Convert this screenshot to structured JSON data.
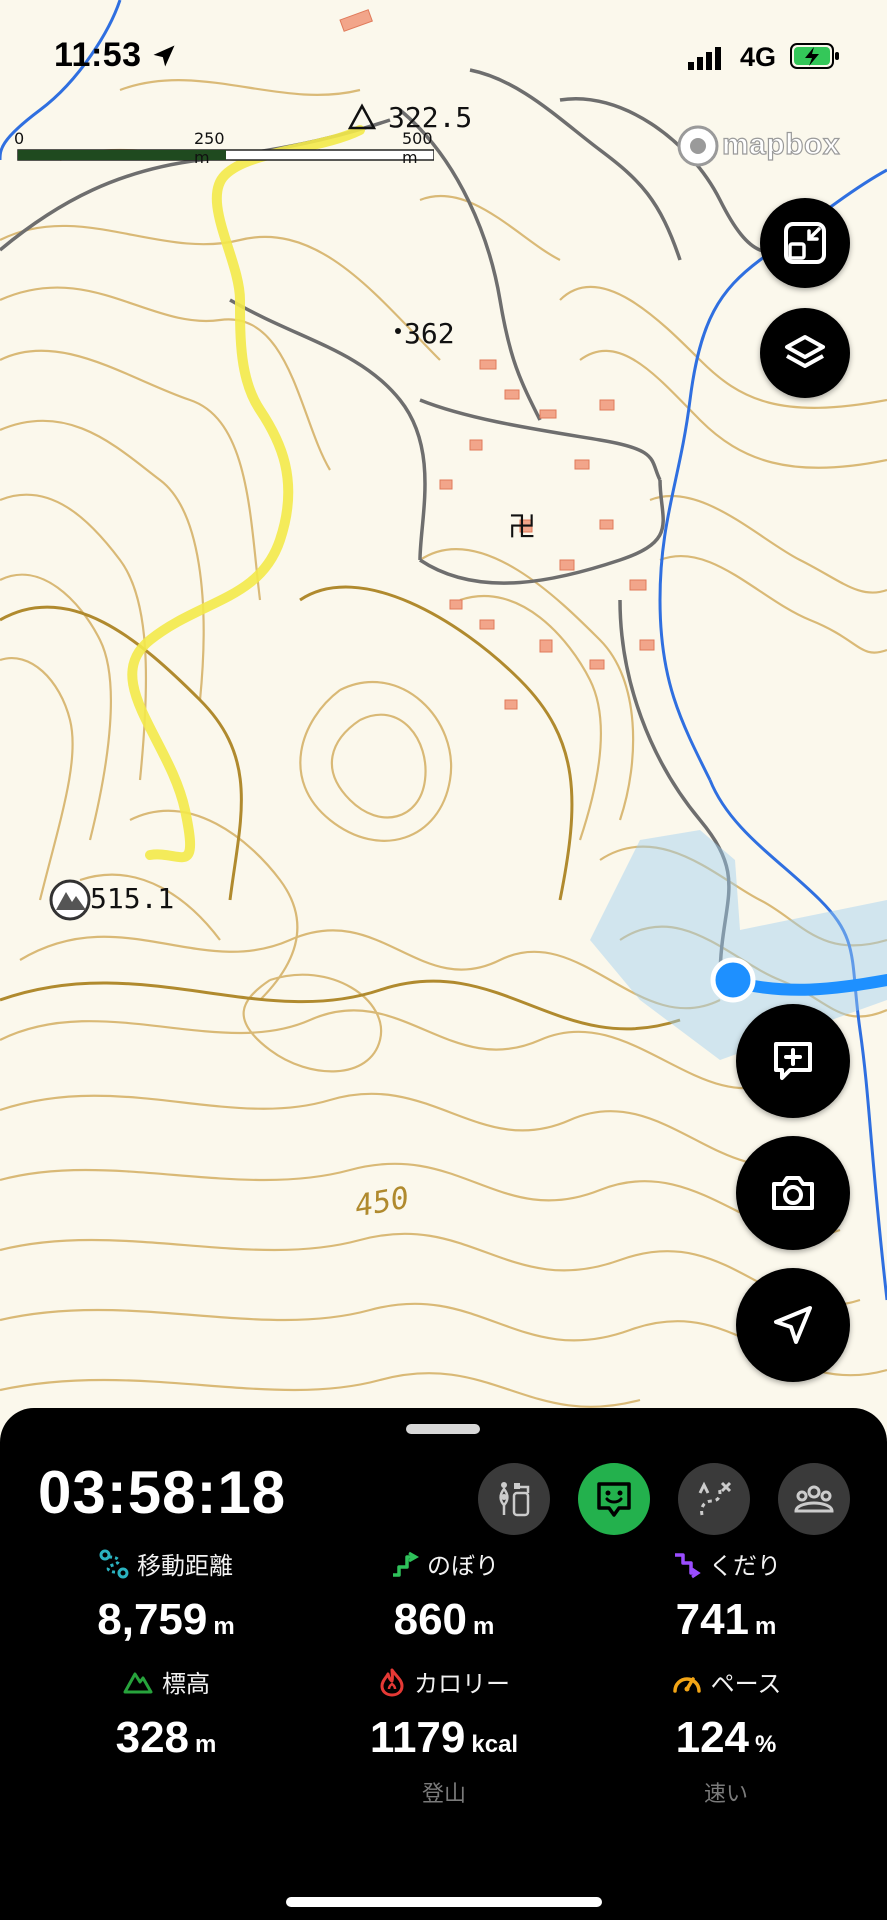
{
  "status_bar": {
    "time": "11:53",
    "network": "4G"
  },
  "map": {
    "scale_labels": [
      "0",
      "250 m",
      "500 m"
    ],
    "attribution": "mapbox",
    "elevation_labels": [
      "322.5",
      "362",
      "515.1",
      "450"
    ]
  },
  "controls": [
    "collapse-icon",
    "layers-icon",
    "add-note-icon",
    "camera-icon",
    "navigate-icon"
  ],
  "panel": {
    "timer": "03:58:18",
    "modes": [
      "hiker-icon",
      "face-icon",
      "route-icon",
      "group-icon"
    ],
    "stats": [
      {
        "label": "移動距離",
        "value": "8,759",
        "unit": "m",
        "icon": "distance-icon",
        "icon_color": "#2bb3c0"
      },
      {
        "label": "のぼり",
        "value": "860",
        "unit": "m",
        "icon": "ascent-icon",
        "icon_color": "#2fc25b"
      },
      {
        "label": "くだり",
        "value": "741",
        "unit": "m",
        "icon": "descent-icon",
        "icon_color": "#9b4dff"
      },
      {
        "label": "標高",
        "value": "328",
        "unit": "m",
        "icon": "mountain-icon",
        "icon_color": "#27a33c"
      },
      {
        "label": "カロリー",
        "value": "1179",
        "unit": "kcal",
        "sub": "登山",
        "icon": "flame-icon",
        "icon_color": "#e53935"
      },
      {
        "label": "ペース",
        "value": "124",
        "unit": "%",
        "sub": "速い",
        "icon": "gauge-icon",
        "icon_color": "#f2a516"
      }
    ]
  }
}
